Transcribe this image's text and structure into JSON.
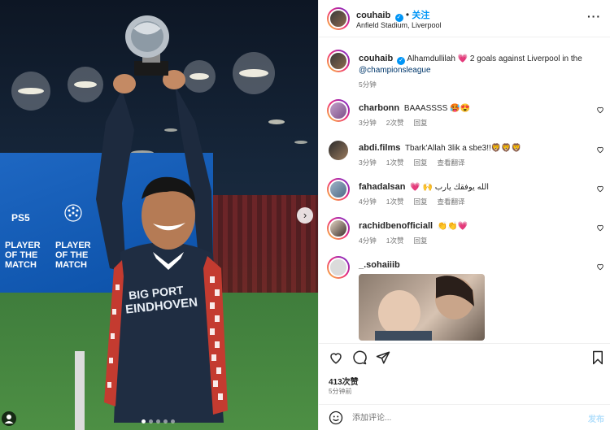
{
  "post": {
    "author": "couhaib",
    "follow_label": "关注",
    "location": "Anfield Stadium, Liverpool",
    "more_label": "···",
    "caption_text": "Alhamdullilah 💗 2 goals against Liverpool in the",
    "caption_link": "@championsleague",
    "caption_time": "5分钟"
  },
  "media": {
    "banner_line1": "PLAYER",
    "banner_line2": "OF THE",
    "banner_line3": "MATCH",
    "banner_ps5": "PS5",
    "next_label": "›",
    "shirt_line1": "BIG PORT",
    "shirt_line2": "EINDHOVEN",
    "carousel_total": 5,
    "carousel_active": 0
  },
  "comments": [
    {
      "user": "charbonn",
      "text": "BAAASSSS 🥵😍",
      "time": "3分钟",
      "likes": "2次赞",
      "reply": "回复",
      "translate": ""
    },
    {
      "user": "abdi.films",
      "text": "Tbark'Allah 3lik a sbe3!!🦁🦁🦁",
      "time": "3分钟",
      "likes": "1次赞",
      "reply": "回复",
      "translate": "查看翻译"
    },
    {
      "user": "fahadalsan",
      "text": "💗 🙌 الله يوفقك يارب",
      "time": "4分钟",
      "likes": "1次赞",
      "reply": "回复",
      "translate": "查看翻译"
    },
    {
      "user": "rachidbenofficiall",
      "text": "👏👏💗",
      "time": "4分钟",
      "likes": "1次赞",
      "reply": "回复",
      "translate": ""
    },
    {
      "user": "_.sohaiiib",
      "text": "",
      "time": "",
      "likes": "",
      "reply": "",
      "translate": ""
    }
  ],
  "footer": {
    "likes": "413次赞",
    "time_ago": "5分钟前",
    "comment_placeholder": "添加评论...",
    "post_label": "发布"
  },
  "colors": {
    "accent": "#0095f6",
    "muted": "#737373",
    "text": "#262626"
  }
}
